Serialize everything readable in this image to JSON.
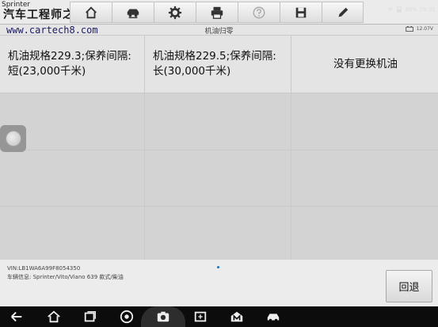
{
  "app": {
    "title": "Sprinter",
    "watermark": "汽车工程师之家"
  },
  "watermark_url": "www.cartech8.com",
  "toolbar": {
    "buttons": [
      {
        "name": "home-button",
        "icon": "home-icon"
      },
      {
        "name": "vehicle-swap-button",
        "icon": "car-swap-icon"
      },
      {
        "name": "settings-button",
        "icon": "gear-icon"
      },
      {
        "name": "print-button",
        "icon": "printer-icon"
      },
      {
        "name": "help-button",
        "icon": "help-icon"
      },
      {
        "name": "save-button",
        "icon": "save-icon"
      },
      {
        "name": "edit-button",
        "icon": "pencil-icon"
      }
    ]
  },
  "header": {
    "page_title": "机油归零",
    "battery_voltage": "12.07V"
  },
  "options": {
    "opt1": "机油规格229.3;保养间隔:短(23,000千米)",
    "opt2": "机油规格229.5;保养间隔:长(30,000千米)",
    "opt3": "没有更换机油"
  },
  "info": {
    "vin": "VIN:LB1WA6A99F8054350",
    "vehicle": "车辆信息: Sprinter/Vito/Viano 639 款式/柴油"
  },
  "actions": {
    "back_label": "回退"
  },
  "status": {
    "battery_percent": "86%",
    "time": "09:31"
  },
  "colors": {
    "nav_bg": "#0c0c0c",
    "toolbar_bg": "#ebebeb",
    "cell_bg": "#e4e4e4",
    "accent_dot": "#1a73c4"
  }
}
